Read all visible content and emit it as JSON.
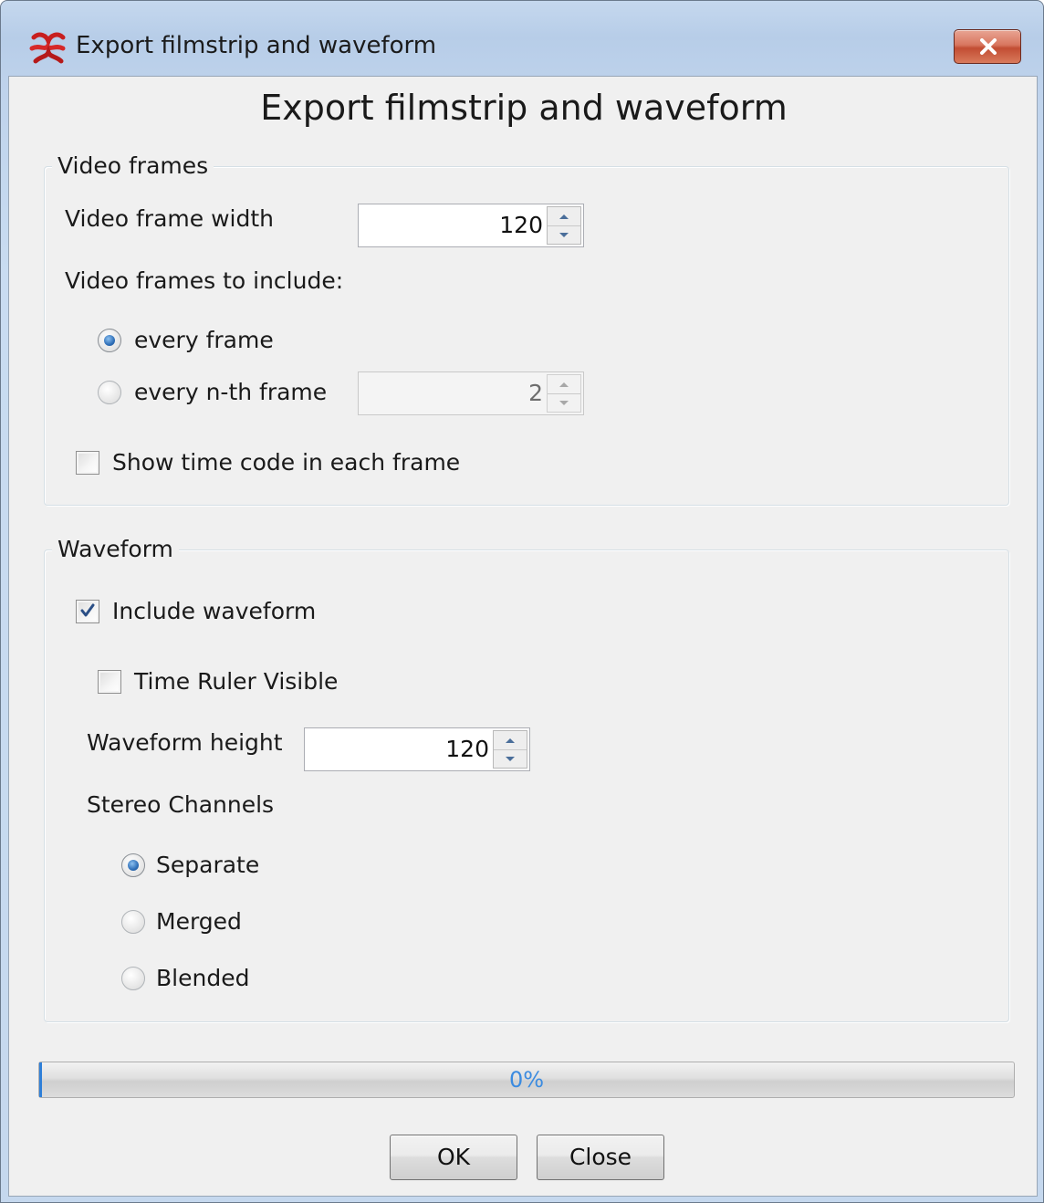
{
  "window": {
    "title": "Export filmstrip and waveform",
    "app_icon": "app-logo-icon",
    "close_icon": "close-icon"
  },
  "dialog": {
    "heading": "Export filmstrip and waveform"
  },
  "video_frames": {
    "legend": "Video frames",
    "frame_width_label": "Video frame width",
    "frame_width_value": "120",
    "frames_to_include_label": "Video frames to include:",
    "options": [
      {
        "label": "every frame",
        "selected": true
      },
      {
        "label": "every n-th frame",
        "selected": false
      }
    ],
    "nth_value": "2",
    "show_time_code_label": "Show time code in each frame",
    "show_time_code_checked": false
  },
  "waveform": {
    "legend": "Waveform",
    "include_label": "Include waveform",
    "include_checked": true,
    "time_ruler_label": "Time Ruler Visible",
    "time_ruler_checked": false,
    "height_label": "Waveform height",
    "height_value": "120",
    "stereo_label": "Stereo Channels",
    "stereo_options": [
      {
        "label": "Separate",
        "selected": true
      },
      {
        "label": "Merged",
        "selected": false
      },
      {
        "label": "Blended",
        "selected": false
      }
    ]
  },
  "progress": {
    "text": "0%",
    "fraction": 0
  },
  "buttons": {
    "ok": "OK",
    "close": "Close"
  },
  "colors": {
    "accent": "#2f7fd8",
    "close_button": "#c9553c"
  }
}
